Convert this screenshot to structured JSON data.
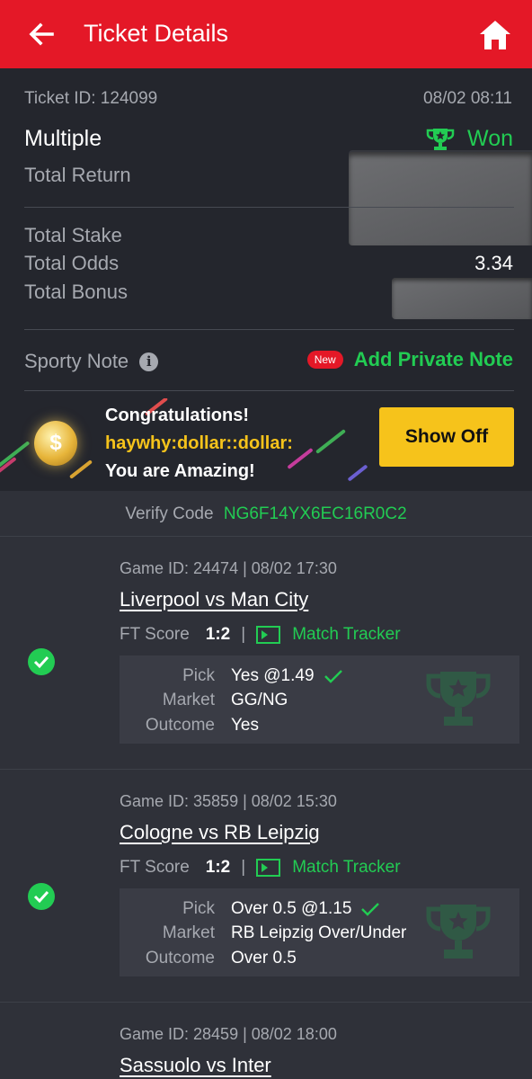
{
  "header": {
    "title": "Ticket Details",
    "back_icon": "arrow-left-icon",
    "home_icon": "home-icon"
  },
  "ticket": {
    "id_text": "Ticket ID: 124099",
    "date": "08/02 08:11",
    "type": "Multiple",
    "status": "Won",
    "total_return_label": "Total Return",
    "total_stake_label": "Total Stake",
    "total_odds_label": "Total Odds",
    "total_odds_value": "3.34",
    "total_bonus_label": "Total Bonus"
  },
  "note": {
    "label": "Sporty Note",
    "new_badge": "New",
    "action": "Add Private Note"
  },
  "congrats": {
    "line1": "Congratulations!",
    "line2": "haywhy:dollar::dollar:",
    "line3": "You are Amazing!",
    "button": "Show Off"
  },
  "verify": {
    "label": "Verify Code",
    "code": "NG6F14YX6EC16R0C2"
  },
  "bets": [
    {
      "meta": "Game ID: 24474 | 08/02 17:30",
      "match": "Liverpool vs Man City",
      "score_label": "FT Score",
      "score": "1:2",
      "separator": "|",
      "tracker": "Match Tracker",
      "pick_label": "Pick",
      "pick": "Yes @1.49",
      "market_label": "Market",
      "market": "GG/NG",
      "outcome_label": "Outcome",
      "outcome": "Yes"
    },
    {
      "meta": "Game ID: 35859 | 08/02 15:30",
      "match": "Cologne vs RB Leipzig",
      "score_label": "FT Score",
      "score": "1:2",
      "separator": "|",
      "tracker": "Match Tracker",
      "pick_label": "Pick",
      "pick": "Over 0.5 @1.15",
      "market_label": "Market",
      "market": "RB Leipzig Over/Under",
      "outcome_label": "Outcome",
      "outcome": "Over 0.5"
    },
    {
      "meta": "Game ID: 28459 | 08/02 18:00",
      "match": "Sassuolo vs Inter"
    }
  ],
  "colors": {
    "accent_red": "#e41827",
    "won_green": "#22cc53",
    "gold": "#f6c31b",
    "background": "#24262d"
  }
}
